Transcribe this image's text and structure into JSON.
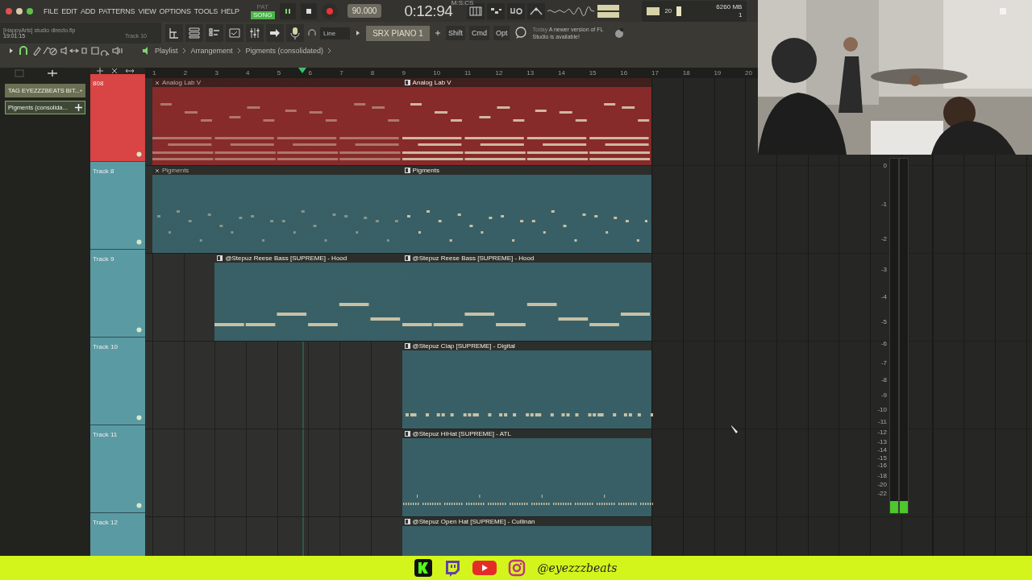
{
  "menu": [
    "FILE",
    "EDIT",
    "ADD",
    "PATTERNS",
    "VIEW",
    "OPTIONS",
    "TOOLS",
    "HELP"
  ],
  "mode": [
    {
      "label": "PAT",
      "selected": false
    },
    {
      "label": "SONG",
      "selected": true
    }
  ],
  "tempo": "90.000",
  "time": {
    "value": "0:12:94",
    "unit": "M:S:CS"
  },
  "monitor": {
    "cpu": "20",
    "memory": "6260 MB",
    "voices": "1"
  },
  "project": {
    "title": "[HappyArts] studio directo.flp",
    "clock": "19:01:15",
    "hint": "Track 10"
  },
  "toolbar": {
    "snap": "Line",
    "channel": "SRX PIANO 1",
    "keys": [
      "Shift",
      "Cmd",
      "Opt"
    ]
  },
  "news": {
    "date": "Today",
    "text": "A newer version of FL Studio is available!"
  },
  "breadcrumb": [
    "Playlist",
    "Arrangement",
    "Pigments (consolidated)"
  ],
  "patterns": [
    {
      "label": "TAG EYEZZZBEATS BIT...",
      "selected": false
    },
    {
      "label": "Pigments (consolida...",
      "selected": true
    }
  ],
  "ruler": [
    "1",
    "2",
    "3",
    "4",
    "5",
    "6",
    "7",
    "8",
    "9",
    "10",
    "11",
    "12",
    "13",
    "14",
    "15",
    "16",
    "17",
    "18",
    "19",
    "20"
  ],
  "tracks": [
    {
      "name": "808",
      "color": "#d94444",
      "clips": [
        {
          "label": "Analog Lab V",
          "muted": true,
          "kind": "chords"
        },
        {
          "label": "Analog Lab V",
          "muted": false,
          "kind": "chords"
        }
      ]
    },
    {
      "name": "Track 8",
      "color": "#5a9aa3",
      "clips": [
        {
          "label": "Pigments",
          "muted": true,
          "kind": "sparse"
        },
        {
          "label": "Pigments",
          "muted": false,
          "kind": "sparse"
        }
      ]
    },
    {
      "name": "Track 9",
      "color": "#5a9aa3",
      "clips": [
        {
          "label": "@Stepuz Reese Bass [SUPREME] - Hood",
          "muted": false,
          "kind": "bass"
        },
        {
          "label": "@Stepuz Reese Bass [SUPREME] - Hood",
          "muted": false,
          "kind": "bass"
        }
      ]
    },
    {
      "name": "Track 10",
      "color": "#5a9aa3",
      "clips": [
        {
          "label": "@Stepuz Clap [SUPREME] - Digital",
          "muted": false,
          "kind": "hits"
        }
      ]
    },
    {
      "name": "Track 11",
      "color": "#5a9aa3",
      "clips": [
        {
          "label": "@Stepuz HiHat [SUPREME] - ATL",
          "muted": false,
          "kind": "hats"
        }
      ]
    },
    {
      "name": "Track 12",
      "color": "#5a9aa3",
      "clips": [
        {
          "label": "@Stepuz Open Hat [SUPREME] - Cullinan",
          "muted": false,
          "kind": "empty"
        }
      ]
    }
  ],
  "meter": {
    "scale": [
      "0",
      "-1",
      "-2",
      "-3",
      "-4",
      "-5",
      "-6",
      "-7",
      "-8",
      "-9",
      "-10",
      "-11",
      "-12",
      "-13",
      "-14",
      "-15",
      "-16",
      "-18",
      "-20",
      "-22"
    ],
    "channels": [
      {
        "level": 0.035
      },
      {
        "level": 0.035
      }
    ]
  },
  "social": {
    "handle": "@eyezzzbeats"
  }
}
